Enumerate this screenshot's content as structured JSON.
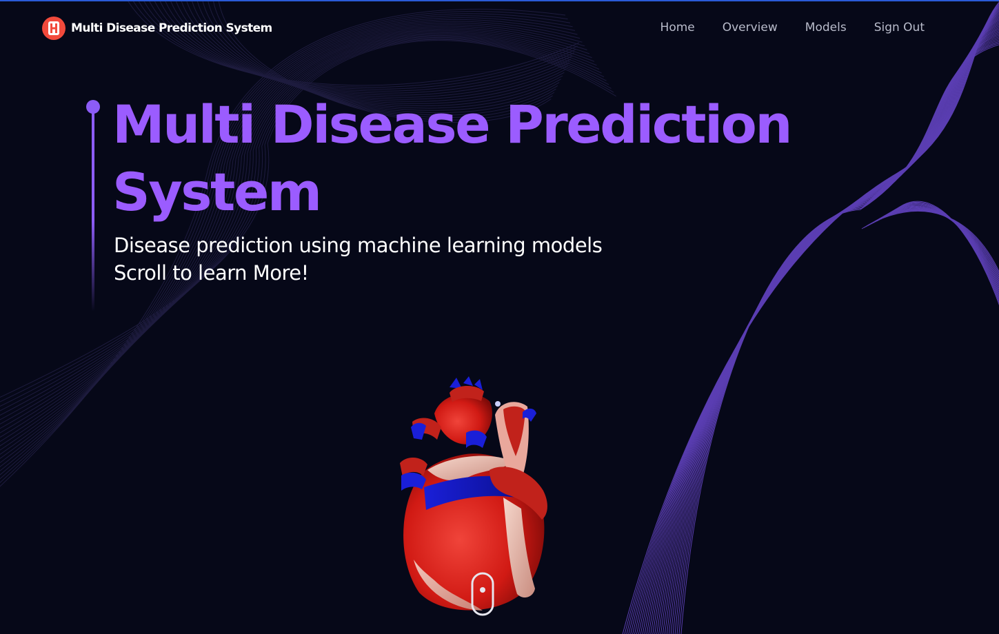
{
  "navbar": {
    "brand": {
      "logo_icon": "hospital-h-logo-icon",
      "title": "Multi Disease Prediction System"
    },
    "links": [
      {
        "label": "Home"
      },
      {
        "label": "Overview"
      },
      {
        "label": "Models"
      },
      {
        "label": "Sign Out"
      }
    ]
  },
  "hero": {
    "title": "Multi Disease Prediction System",
    "subtitle_line1": "Disease prediction using machine learning models",
    "subtitle_line2": "Scroll to learn More!"
  },
  "visual": {
    "model": "3d-heart-model",
    "scroll_icon": "mouse-scroll-icon"
  },
  "colors": {
    "background": "#060818",
    "accent": "#9b5cff",
    "logo": "#f24a3c",
    "nav_text": "#b9bccb",
    "text": "#ffffff",
    "top_border": "#2a5bd7"
  }
}
